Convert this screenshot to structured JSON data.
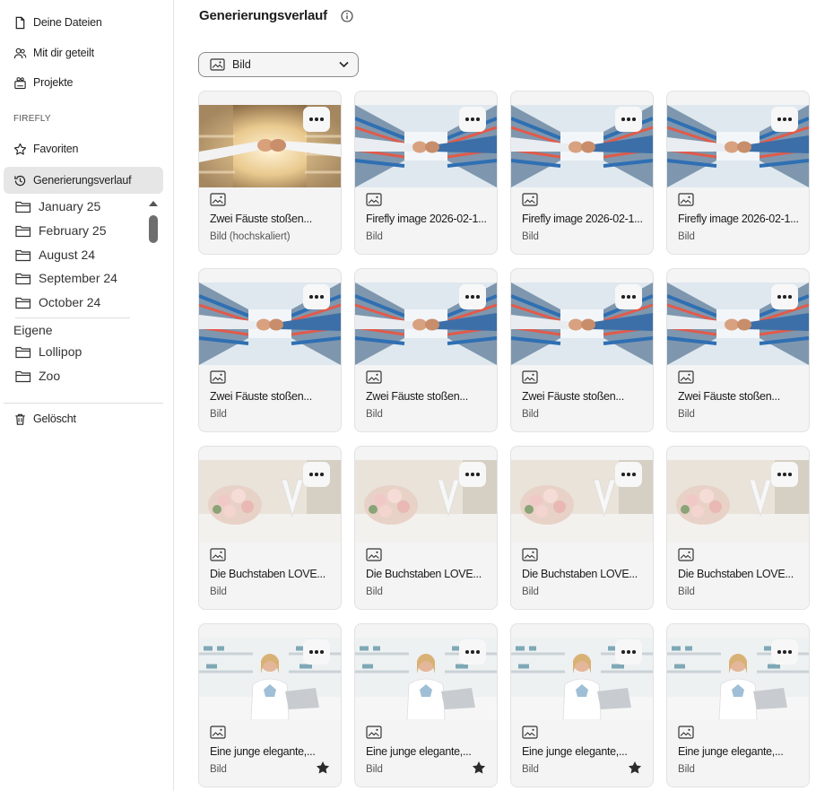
{
  "sidebar": {
    "nav": [
      {
        "label": "Deine Dateien",
        "icon": "file-icon"
      },
      {
        "label": "Mit dir geteilt",
        "icon": "shared-users-icon"
      },
      {
        "label": "Projekte",
        "icon": "projects-icon"
      }
    ],
    "section_label": "FIREFLY",
    "firefly": [
      {
        "label": "Favoriten",
        "icon": "star-outline-icon"
      },
      {
        "label": "Generierungsverlauf",
        "icon": "history-icon",
        "active": true
      }
    ],
    "folders": [
      "January 25",
      "February 25",
      "August 24",
      "September 24",
      "October 24"
    ],
    "own_label": "Eigene",
    "own_folders": [
      "Lollipop",
      "Zoo"
    ],
    "deleted": {
      "label": "Gelöscht",
      "icon": "trash-icon"
    }
  },
  "main": {
    "title": "Generierungsverlauf",
    "filter": {
      "selected": "Bild",
      "icon": "image-icon"
    },
    "cards": [
      {
        "title": "Zwei Fäuste stoßen...",
        "sub": "Bild (hochskaliert)",
        "scene": "fist-warm",
        "fav": false
      },
      {
        "title": "Firefly image 2026-02-1...",
        "sub": "Bild",
        "scene": "fist-pharmacy",
        "fav": false
      },
      {
        "title": "Firefly image 2026-02-1...",
        "sub": "Bild",
        "scene": "fist-pharmacy",
        "fav": false
      },
      {
        "title": "Firefly image 2026-02-1...",
        "sub": "Bild",
        "scene": "fist-pharmacy",
        "fav": false
      },
      {
        "title": "Zwei Fäuste stoßen...",
        "sub": "Bild",
        "scene": "fist-pharmacy",
        "fav": false
      },
      {
        "title": "Zwei Fäuste stoßen...",
        "sub": "Bild",
        "scene": "fist-pharmacy",
        "fav": false
      },
      {
        "title": "Zwei Fäuste stoßen...",
        "sub": "Bild",
        "scene": "fist-pharmacy",
        "fav": false
      },
      {
        "title": "Zwei Fäuste stoßen...",
        "sub": "Bild",
        "scene": "fist-pharmacy",
        "fav": false
      },
      {
        "title": "Die Buchstaben LOVE...",
        "sub": "Bild",
        "scene": "bouquet",
        "fav": false
      },
      {
        "title": "Die Buchstaben LOVE...",
        "sub": "Bild",
        "scene": "bouquet",
        "fav": false
      },
      {
        "title": "Die Buchstaben LOVE...",
        "sub": "Bild",
        "scene": "bouquet",
        "fav": false
      },
      {
        "title": "Die Buchstaben LOVE...",
        "sub": "Bild",
        "scene": "bouquet",
        "fav": false
      },
      {
        "title": "Eine junge elegante,...",
        "sub": "Bild",
        "scene": "pharmacist",
        "fav": true
      },
      {
        "title": "Eine junge elegante,...",
        "sub": "Bild",
        "scene": "pharmacist",
        "fav": true
      },
      {
        "title": "Eine junge elegante,...",
        "sub": "Bild",
        "scene": "pharmacist",
        "fav": true
      },
      {
        "title": "Eine junge elegante,...",
        "sub": "Bild",
        "scene": "pharmacist",
        "fav": false
      }
    ]
  }
}
